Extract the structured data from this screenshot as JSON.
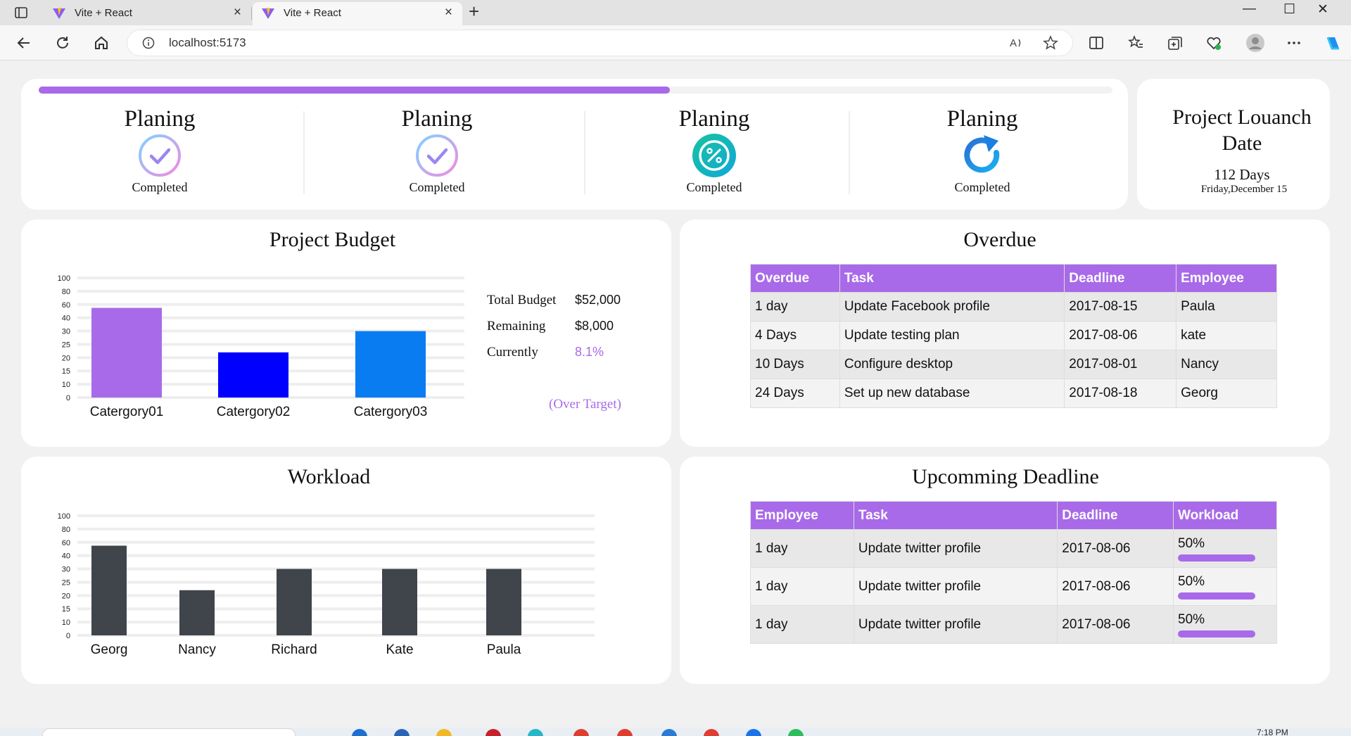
{
  "browser": {
    "tabs": [
      {
        "title": "Vite + React",
        "active": false
      },
      {
        "title": "Vite + React",
        "active": true
      }
    ],
    "url": "localhost:5173",
    "new_tab": "+",
    "window_controls": {
      "minimize": "—",
      "maximize": "☐",
      "close": "✕"
    }
  },
  "progress": {
    "fraction": 0.588
  },
  "stages": [
    {
      "title": "Planing",
      "status": "Completed",
      "icon": "check-circle-icon"
    },
    {
      "title": "Planing",
      "status": "Completed",
      "icon": "check-circle-icon"
    },
    {
      "title": "Planing",
      "status": "Completed",
      "icon": "percent-circle-icon"
    },
    {
      "title": "Planing",
      "status": "Completed",
      "icon": "refresh-icon"
    }
  ],
  "launch": {
    "title": "Project Louanch Date",
    "days": "112 Days",
    "date": "Friday,December 15"
  },
  "budget": {
    "title": "Project Budget",
    "rows": [
      {
        "label": "Total Budget",
        "value": "$52,000"
      },
      {
        "label": "Remaining",
        "value": "$8,000"
      },
      {
        "label": "Currently",
        "value": "8.1%"
      }
    ],
    "note": "(Over Target)"
  },
  "overdue": {
    "title": "Overdue",
    "headers": [
      "Overdue",
      "Task",
      "Deadline",
      "Employee"
    ],
    "rows": [
      [
        "1 day",
        "Update Facebook profile",
        "2017-08-15",
        "Paula"
      ],
      [
        "4 Days",
        "Update testing plan",
        "2017-08-06",
        "kate"
      ],
      [
        "10 Days",
        "Configure desktop",
        "2017-08-01",
        "Nancy"
      ],
      [
        "24 Days",
        "Set up new database",
        "2017-08-18",
        "Georg"
      ]
    ]
  },
  "workload_title": "Workload",
  "upcoming": {
    "title": "Upcomming Deadline",
    "headers": [
      "Employee",
      "Task",
      "Deadline",
      "Workload"
    ],
    "rows": [
      {
        "employee": "1 day",
        "task": "Update twitter profile",
        "deadline": "2017-08-06",
        "workload": "50%"
      },
      {
        "employee": "1 day",
        "task": "Update twitter profile",
        "deadline": "2017-08-06",
        "workload": "50%"
      },
      {
        "employee": "1 day",
        "task": "Update twitter profile",
        "deadline": "2017-08-06",
        "workload": "50%"
      }
    ]
  },
  "colors": {
    "accent": "#a86ae8",
    "bar2": "#0000ff",
    "bar3": "#0a7cf2",
    "workload_bar": "#40444b"
  },
  "taskbar": {
    "time": "7:18 PM"
  },
  "chart_data": [
    {
      "type": "bar",
      "title": "",
      "categories": [
        "Catergory01",
        "Catergory02",
        "Catergory03"
      ],
      "values": [
        55,
        22,
        30
      ],
      "yticks": [
        "0",
        "10",
        "15",
        "20",
        "25",
        "30",
        "40",
        "60",
        "80",
        "100"
      ],
      "colors": [
        "#a86ae8",
        "#0000ff",
        "#0a7cf2"
      ],
      "grid": true
    },
    {
      "type": "bar",
      "title": "",
      "categories": [
        "Georg",
        "Nancy",
        "Richard",
        "Kate",
        "Paula"
      ],
      "values": [
        55,
        22,
        30,
        30,
        30
      ],
      "yticks": [
        "0",
        "10",
        "15",
        "20",
        "25",
        "30",
        "40",
        "60",
        "80",
        "100"
      ],
      "colors": [
        "#40444b"
      ],
      "grid": true
    }
  ]
}
